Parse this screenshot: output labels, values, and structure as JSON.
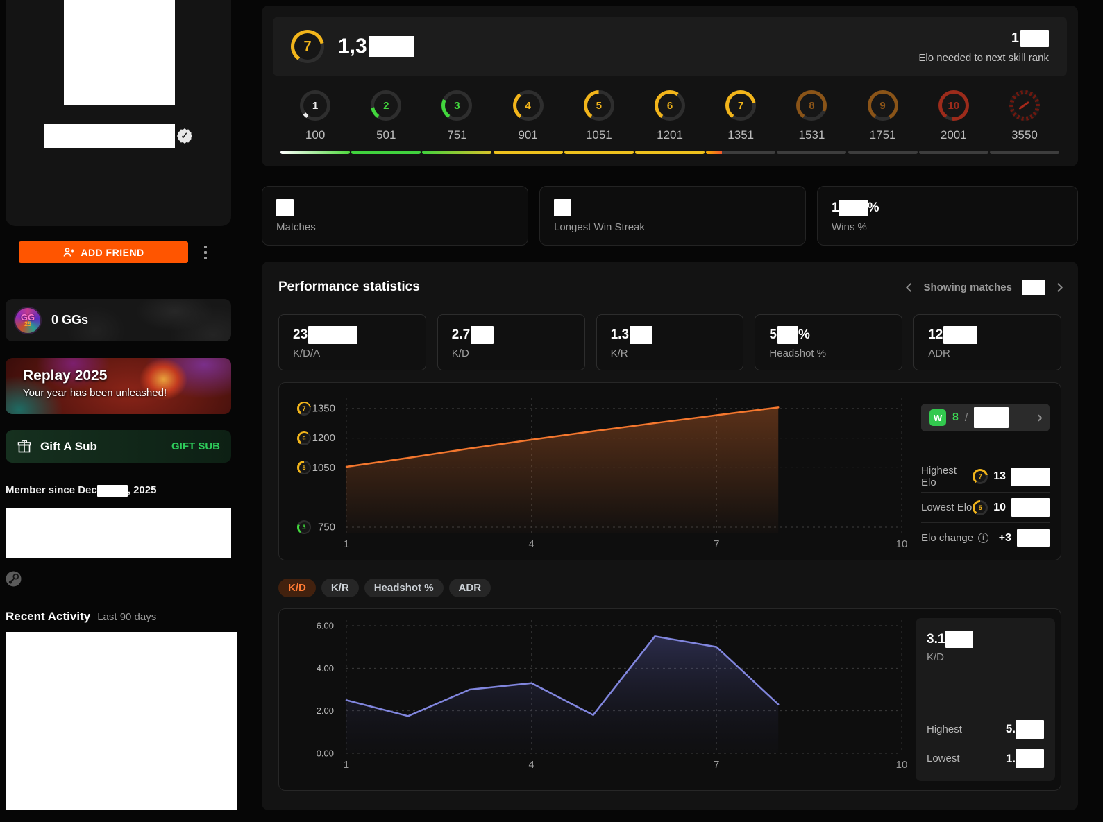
{
  "sidebar": {
    "add_friend": "ADD FRIEND",
    "gg": {
      "label": "0 GGs",
      "logo_top": "GG",
      "logo_year": "25"
    },
    "replay": {
      "title": "Replay 2025",
      "subtitle": "Your year has been unleashed!"
    },
    "gift": {
      "label": "Gift A Sub",
      "button": "GIFT SUB"
    },
    "member_since": {
      "prefix": "Member since Dec",
      "suffix": ", 2025"
    },
    "recent_activity": {
      "title": "Recent Activity",
      "range": "Last 90 days"
    }
  },
  "elo_header": {
    "level": "7",
    "elo_prefix": "1,3",
    "next_prefix": "1",
    "next_label": "Elo needed to next skill rank",
    "level_progress_pct": 23
  },
  "skill_levels": [
    {
      "level": "1",
      "threshold": "100"
    },
    {
      "level": "2",
      "threshold": "501"
    },
    {
      "level": "3",
      "threshold": "751"
    },
    {
      "level": "4",
      "threshold": "901"
    },
    {
      "level": "5",
      "threshold": "1051"
    },
    {
      "level": "6",
      "threshold": "1201"
    },
    {
      "level": "7",
      "threshold": "1351"
    },
    {
      "level": "8",
      "threshold": "1531"
    },
    {
      "level": "9",
      "threshold": "1751"
    },
    {
      "level": "10",
      "threshold": "2001"
    },
    {
      "level": "challenger",
      "threshold": "3550"
    }
  ],
  "summary_cards": [
    {
      "label": "Matches",
      "value_prefix": "",
      "value_suffix": ""
    },
    {
      "label": "Longest Win Streak",
      "value_prefix": "",
      "value_suffix": ""
    },
    {
      "label": "Wins %",
      "value_prefix": "1",
      "value_suffix": "%"
    }
  ],
  "performance": {
    "title": "Performance statistics",
    "showing_matches": "Showing matches",
    "stats": [
      {
        "value_prefix": "23",
        "value_suffix": "",
        "label": "K/D/A"
      },
      {
        "value_prefix": "2.7",
        "value_suffix": "",
        "label": "K/D"
      },
      {
        "value_prefix": "1.3",
        "value_suffix": "",
        "label": "K/R"
      },
      {
        "value_prefix": "5",
        "value_suffix": "%",
        "label": "Headshot %"
      },
      {
        "value_prefix": "12",
        "value_suffix": "",
        "label": "ADR"
      }
    ],
    "elo_panel": {
      "result_badge": "W",
      "result_count": "8",
      "separator": "/",
      "highest_label": "Highest Elo",
      "highest_badge": "7",
      "highest_prefix": "13",
      "lowest_label": "Lowest Elo",
      "lowest_badge": "5",
      "lowest_prefix": "10",
      "change_label": "Elo change",
      "change_prefix": "+3"
    },
    "tabs": [
      {
        "label": "K/D",
        "active": true
      },
      {
        "label": "K/R",
        "active": false
      },
      {
        "label": "Headshot %",
        "active": false
      },
      {
        "label": "ADR",
        "active": false
      }
    ],
    "kd_panel": {
      "value_prefix": "3.1",
      "label": "K/D",
      "highest_label": "Highest",
      "highest_prefix": "5.",
      "lowest_label": "Lowest",
      "lowest_prefix": "1."
    }
  },
  "chart_data": [
    {
      "type": "area",
      "title": "Elo history",
      "x": [
        1,
        2,
        3,
        4,
        5,
        6,
        7,
        8
      ],
      "y": [
        1055,
        1100,
        1148,
        1192,
        1235,
        1276,
        1316,
        1355
      ],
      "x_ticks": [
        1,
        4,
        7,
        10
      ],
      "y_ticks": [
        {
          "value": 1350,
          "label": "1350",
          "badge": "7"
        },
        {
          "value": 1200,
          "label": "1200",
          "badge": "6"
        },
        {
          "value": 1050,
          "label": "1050",
          "badge": "5"
        },
        {
          "value": 750,
          "label": "750",
          "badge": "3"
        }
      ],
      "xlim": [
        1,
        10
      ],
      "ylim": [
        722,
        1402
      ],
      "grid": "dashed",
      "legend": "none",
      "line_color": "#f4772e"
    },
    {
      "type": "area",
      "title": "K/D per match",
      "x": [
        1,
        2,
        3,
        4,
        5,
        6,
        7,
        8
      ],
      "y": [
        2.5,
        1.75,
        3.0,
        3.3,
        1.8,
        5.5,
        5.0,
        2.3
      ],
      "x_ticks": [
        1,
        4,
        7,
        10
      ],
      "y_ticks": [
        {
          "value": 6,
          "label": "6.00"
        },
        {
          "value": 4,
          "label": "4.00"
        },
        {
          "value": 2,
          "label": "2.00"
        },
        {
          "value": 0,
          "label": "0.00"
        }
      ],
      "xlim": [
        1,
        10
      ],
      "ylim": [
        0,
        6.26
      ],
      "grid": "dashed",
      "legend": "none",
      "line_color": "#8186de"
    }
  ],
  "colors": {
    "accent_orange": "#ff5500",
    "elo_line": "#f4772e",
    "kd_line": "#8186de",
    "win_green": "#3ddc54",
    "level_yellow": "#f2b51b",
    "gift_green": "#2ecc5b"
  }
}
